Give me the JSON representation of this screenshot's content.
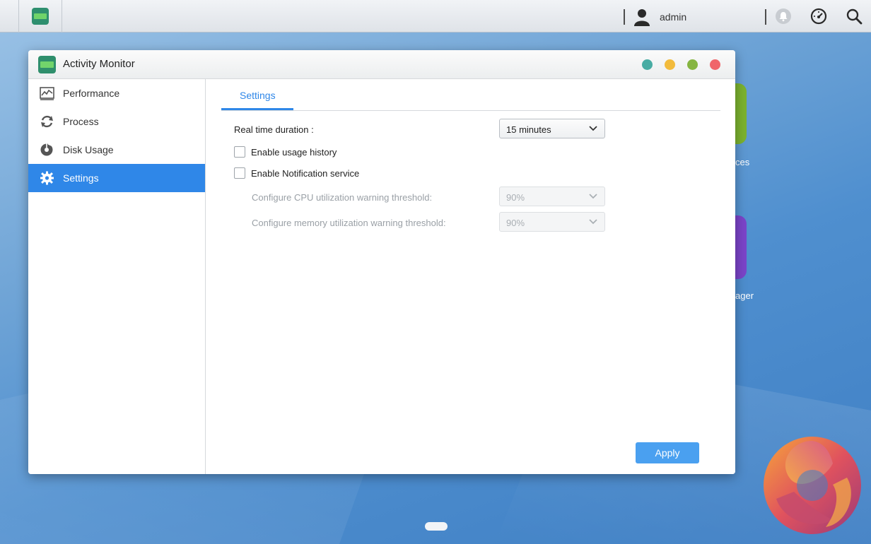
{
  "topbar": {
    "apps_icon": "activity-monitor-icon",
    "user_icon": "user-icon",
    "username": "admin",
    "notification_icon": "bell-icon",
    "dashboard_icon": "gauge-icon",
    "search_icon": "search-icon"
  },
  "desktop": {
    "icon1_label_partial": "ces",
    "icon2_label_partial": "ager"
  },
  "window": {
    "title": "Activity Monitor",
    "controls": [
      {
        "name": "minimize",
        "color": "#48aca3"
      },
      {
        "name": "restore",
        "color": "#f2bb3c"
      },
      {
        "name": "maximize",
        "color": "#86b541"
      },
      {
        "name": "close",
        "color": "#f0656a"
      }
    ]
  },
  "sidebar": {
    "items": [
      {
        "label": "Performance",
        "icon": "performance-chart-icon"
      },
      {
        "label": "Process",
        "icon": "process-cycle-icon"
      },
      {
        "label": "Disk Usage",
        "icon": "disk-usage-pie-icon"
      },
      {
        "label": "Settings",
        "icon": "gear-icon",
        "active": true
      }
    ]
  },
  "settings": {
    "tab_label": "Settings",
    "real_time_label": "Real time duration :",
    "real_time_value": "15 minutes",
    "usage_history_label": "Enable usage history",
    "usage_history_checked": false,
    "notification_label": "Enable Notification service",
    "notification_checked": false,
    "cpu_threshold_label": "Configure CPU utilization warning threshold:",
    "cpu_threshold_value": "90%",
    "memory_threshold_label": "Configure memory utilization warning threshold:",
    "memory_threshold_value": "90%",
    "apply_label": "Apply"
  },
  "colors": {
    "accent": "#2f87e8",
    "apply_button": "#4aa0f0"
  }
}
